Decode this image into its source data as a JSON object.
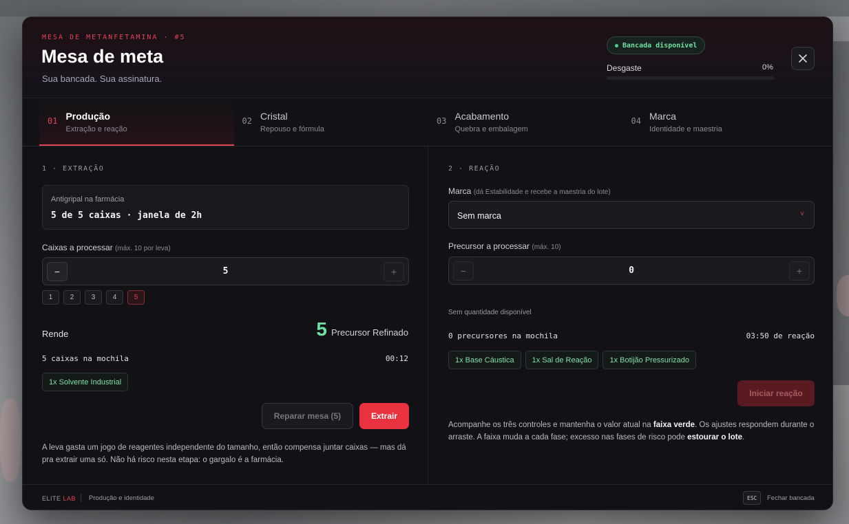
{
  "header": {
    "eyebrow": "MESA DE METANFETAMINA · #5",
    "title": "Mesa de meta",
    "subtitle": "Sua bancada. Sua assinatura.",
    "status_badge": "Bancada disponível",
    "wear_label": "Desgaste",
    "wear_value": "0%",
    "wear_fraction": 0
  },
  "tabs": [
    {
      "num": "01",
      "title": "Produção",
      "sub": "Extração e reação",
      "active": true
    },
    {
      "num": "02",
      "title": "Cristal",
      "sub": "Repouso e fórmula",
      "active": false
    },
    {
      "num": "03",
      "title": "Acabamento",
      "sub": "Quebra e embalagem",
      "active": false
    },
    {
      "num": "04",
      "title": "Marca",
      "sub": "Identidade e maestria",
      "active": false
    }
  ],
  "extraction": {
    "section_title": "1 · EXTRAÇÃO",
    "info_label": "Antigripal na farmácia",
    "info_value": "5 de 5 caixas · janela de 2h",
    "boxes_label": "Caixas a processar",
    "boxes_hint": "(máx. 10 por leva)",
    "minus": "−",
    "plus": "+",
    "value": "5",
    "quick": [
      "1",
      "2",
      "3",
      "4",
      "5"
    ],
    "quick_active": "5",
    "yield_label": "Rende",
    "yield_num": "5",
    "yield_unit": "Precursor Refinado",
    "inventory": "5 caixas na mochila",
    "time": "00:12",
    "chips": [
      "1x Solvente Industrial"
    ],
    "repair_button": "Reparar mesa (5)",
    "extract_button": "Extrair",
    "note": "A leva gasta um jogo de reagentes independente do tamanho, então compensa juntar caixas — mas dá pra extrair uma só. Não há risco nesta etapa: o gargalo é a farmácia."
  },
  "reaction": {
    "section_title": "2 · REAÇÃO",
    "brand_label": "Marca",
    "brand_hint": "(dá Estabilidade e recebe a maestria do lote)",
    "brand_value": "Sem marca",
    "caret": "˅",
    "precursor_label": "Precursor a processar",
    "precursor_hint": "(máx. 10)",
    "minus": "−",
    "plus": "+",
    "value": "0",
    "availability": "Sem quantidade disponível",
    "inventory": "0 precursores na mochila",
    "time": "03:50 de reação",
    "chips": [
      "1x Base Cáustica",
      "1x Sal de Reação",
      "1x Botijão Pressurizado"
    ],
    "start_button": "Iniciar reação",
    "note_p1": "Acompanhe os três controles e mantenha o valor atual na ",
    "note_b1": "faixa verde",
    "note_p2": ". Os ajustes respondem durante o arraste. A faixa muda a cada fase; excesso nas fases de risco pode ",
    "note_b2": "estourar o lote",
    "note_p3": "."
  },
  "footer": {
    "brand": "ELITE",
    "brand_accent": "LAB",
    "description": "Produção e identidade",
    "esc_key": "ESC",
    "esc_label": "Fechar bancada"
  },
  "colors": {
    "accent": "#e04353",
    "success": "#6ee0a4",
    "background": "#121216"
  }
}
